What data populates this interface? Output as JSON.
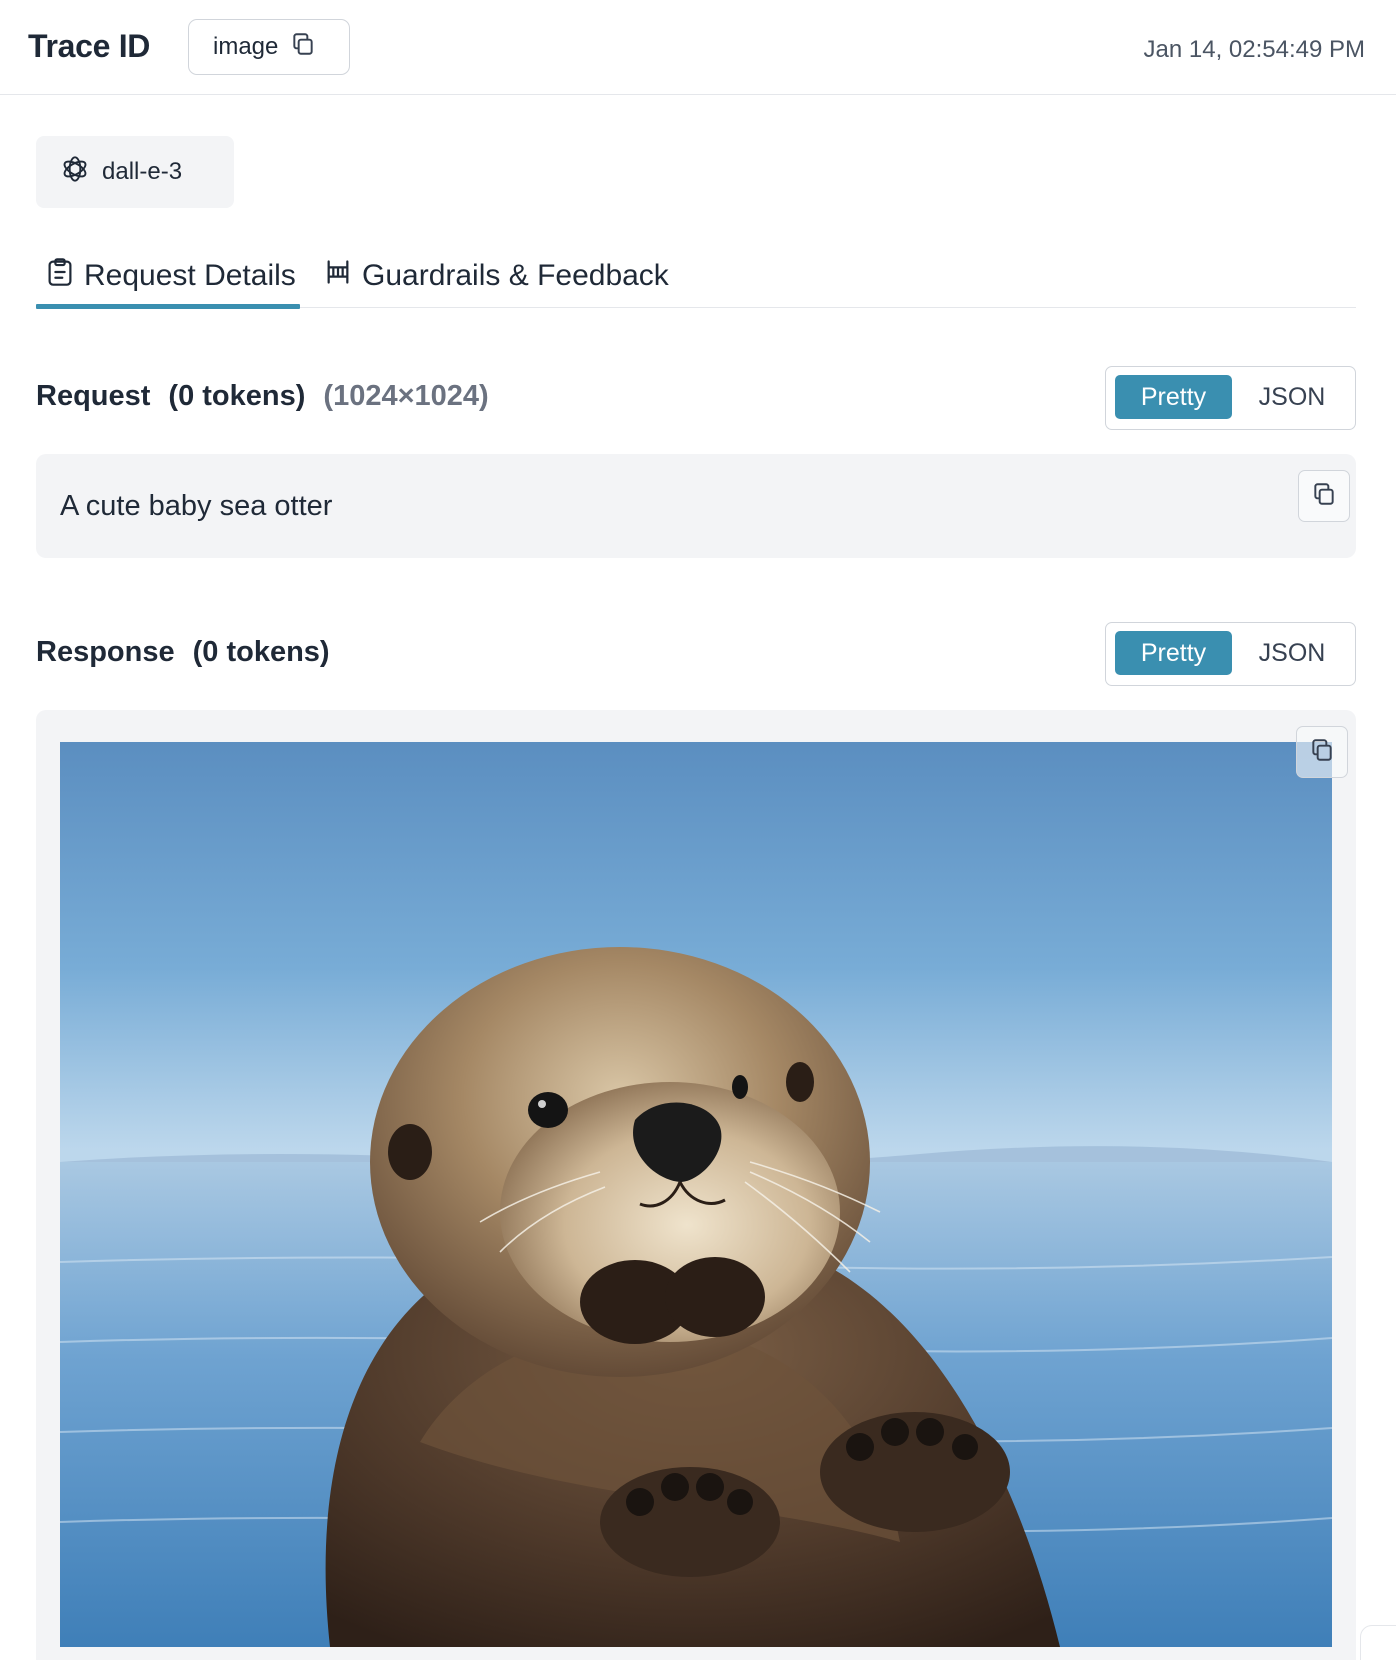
{
  "header": {
    "title": "Trace ID",
    "id_chip_label": "image",
    "timestamp": "Jan 14, 02:54:49 PM"
  },
  "model": {
    "name": "dall-e-3",
    "icon": "openai-logo-icon"
  },
  "tabs": [
    {
      "label": "Request Details",
      "icon": "clipboard-icon",
      "active": true
    },
    {
      "label": "Guardrails & Feedback",
      "icon": "guardrails-icon",
      "active": false
    }
  ],
  "request": {
    "title": "Request",
    "tokens": "(0 tokens)",
    "size": "(1024×1024)",
    "toggle": {
      "pretty": "Pretty",
      "json": "JSON",
      "selected": "Pretty"
    },
    "prompt": "A cute baby sea otter"
  },
  "response": {
    "title": "Response",
    "tokens": "(0 tokens)",
    "toggle": {
      "pretty": "Pretty",
      "json": "JSON",
      "selected": "Pretty"
    },
    "image_subject": "baby sea otter floating on blue water"
  },
  "colors": {
    "accent": "#3a8fb0",
    "panel_bg": "#f3f4f6",
    "border": "#d1d5db"
  }
}
